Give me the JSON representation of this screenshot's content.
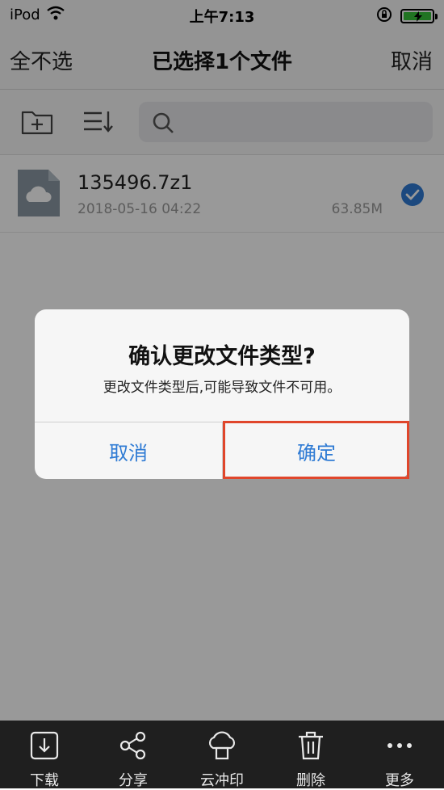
{
  "status_bar": {
    "device": "iPod",
    "time": "上午7:13"
  },
  "nav": {
    "left": "全不选",
    "title": "已选择1个文件",
    "right": "取消"
  },
  "file": {
    "name": "135496.7z1",
    "date": "2018-05-16 04:22",
    "size": "63.85M",
    "selected": true
  },
  "dialog": {
    "title": "确认更改文件类型?",
    "message": "更改文件类型后,可能导致文件不可用。",
    "cancel": "取消",
    "confirm": "确定"
  },
  "tabbar": {
    "items": [
      {
        "label": "下载",
        "icon": "download-icon"
      },
      {
        "label": "分享",
        "icon": "share-icon"
      },
      {
        "label": "云冲印",
        "icon": "cloud-print-icon"
      },
      {
        "label": "删除",
        "icon": "trash-icon"
      },
      {
        "label": "更多",
        "icon": "more-icon"
      }
    ]
  },
  "colors": {
    "accent": "#2f7bd4",
    "highlight": "#e0462b",
    "battery": "#38c23a",
    "tabbar": "#1f1f1f"
  }
}
